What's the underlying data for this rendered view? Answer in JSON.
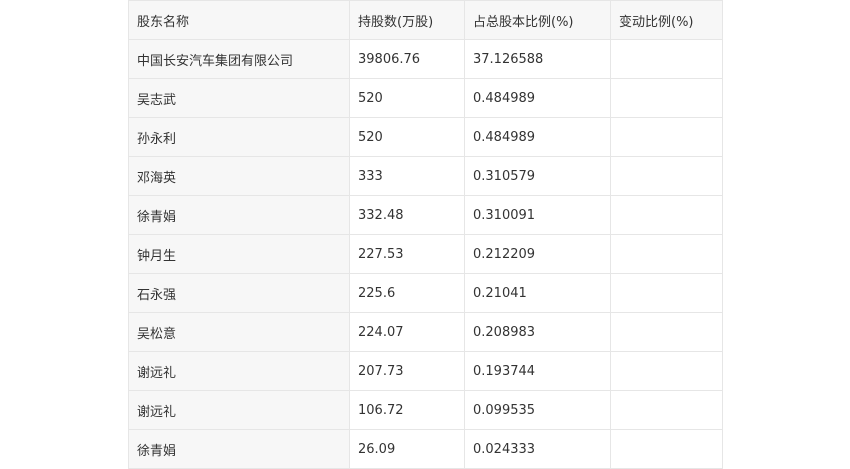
{
  "table": {
    "headers": [
      "股东名称",
      "持股数(万股)",
      "占总股本比例(%)",
      "变动比例(%)"
    ],
    "rows": [
      [
        "中国长安汽车集团有限公司",
        "39806.76",
        "37.126588",
        ""
      ],
      [
        "吴志武",
        "520",
        "0.484989",
        ""
      ],
      [
        "孙永利",
        "520",
        "0.484989",
        ""
      ],
      [
        "邓海英",
        "333",
        "0.310579",
        ""
      ],
      [
        "徐青娟",
        "332.48",
        "0.310091",
        ""
      ],
      [
        "钟月生",
        "227.53",
        "0.212209",
        ""
      ],
      [
        "石永强",
        "225.6",
        "0.21041",
        ""
      ],
      [
        "吴松意",
        "224.07",
        "0.208983",
        ""
      ],
      [
        "谢远礼",
        "207.73",
        "0.193744",
        ""
      ],
      [
        "谢远礼",
        "106.72",
        "0.099535",
        ""
      ],
      [
        "徐青娟",
        "26.09",
        "0.024333",
        ""
      ]
    ]
  }
}
